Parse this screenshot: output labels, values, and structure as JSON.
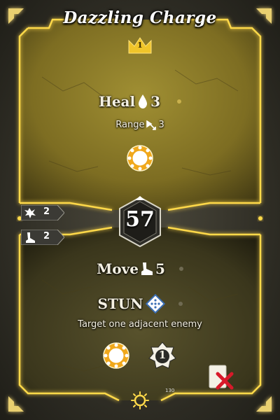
{
  "card": {
    "title": "Dazzling Charge",
    "level": "1",
    "initiative": "57",
    "card_number": "130",
    "top": {
      "heal_label": "Heal",
      "heal_value": "3",
      "range_label": "Range",
      "range_value": "3"
    },
    "bottom": {
      "move_label": "Move",
      "move_value": "5",
      "stun_label": "STUN",
      "target_text": "Target one adjacent enemy",
      "bonus_value": "1"
    },
    "side_badges": [
      {
        "icon": "attack-burst-icon",
        "value": "2"
      },
      {
        "icon": "boot-move-icon",
        "value": "2"
      }
    ]
  },
  "colors": {
    "frame_glow": "#ffd94a",
    "top_panel": "#8a7a26",
    "bottom_panel": "#4a4523",
    "sun_element": "#f0a81c",
    "lost_red": "#d8192a",
    "top_dot": "#c9b04c",
    "bottom_dot": "#6f6a52"
  }
}
